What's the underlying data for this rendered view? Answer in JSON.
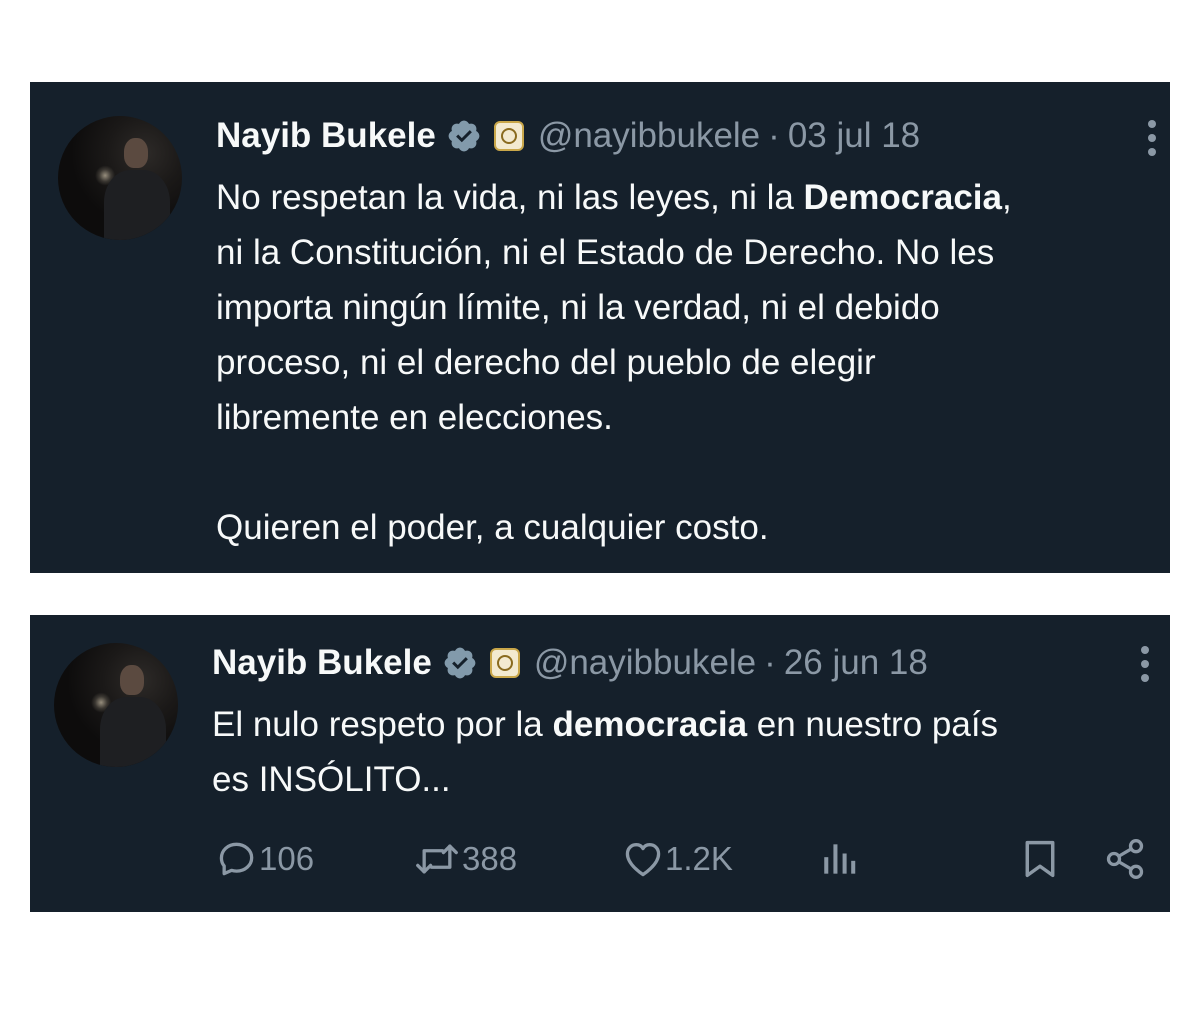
{
  "tweets": [
    {
      "author": {
        "name": "Nayib Bukele",
        "handle": "@nayibbukele",
        "verified_icon": "verified-badge-icon",
        "affiliate_icon": "el-salvador-seal-icon"
      },
      "separator": "·",
      "date": "03 jul 18",
      "text": {
        "line1_prefix": "No respetan la vida, ni las leyes, ni la ",
        "line1_bold": "Democracia",
        "line1_suffix": ",",
        "line2": "ni la Constitución, ni el Estado de Derecho. No les",
        "line3": "importa ningún límite, ni la verdad, ni el debido",
        "line4": "proceso, ni el derecho del pueblo de elegir",
        "line5": "libremente en elecciones.",
        "line6": "Quieren el poder, a cualquier costo."
      }
    },
    {
      "author": {
        "name": "Nayib Bukele",
        "handle": "@nayibbukele",
        "verified_icon": "verified-badge-icon",
        "affiliate_icon": "el-salvador-seal-icon"
      },
      "separator": "·",
      "date": "26 jun 18",
      "text": {
        "line1_prefix": "El nulo respeto por la ",
        "line1_bold": "democracia",
        "line1_suffix": " en nuestro país",
        "line2": "es INSÓLITO..."
      },
      "actions": {
        "replies": "106",
        "retweets": "388",
        "likes": "1.2K",
        "views_icon": "analytics-icon",
        "bookmark_icon": "bookmark-icon",
        "share_icon": "share-icon"
      }
    }
  ],
  "colors": {
    "card_background": "#15202b",
    "primary_text": "#f7f9f9",
    "secondary_text": "#8b98a5",
    "page_background": "#ffffff"
  }
}
